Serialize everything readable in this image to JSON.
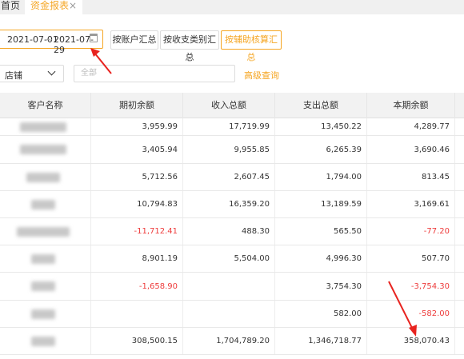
{
  "tabs": [
    {
      "label": "首页"
    },
    {
      "label": "资金报表",
      "close": "×"
    }
  ],
  "filters": {
    "date_start": "2021-07-01",
    "date_sep": "~",
    "date_end": "2021-07-29",
    "buttons": [
      "按账户汇总",
      "按收支类别汇总",
      "按辅助核算汇总"
    ],
    "active_button": "按辅助核算汇总",
    "shop_label": "店铺",
    "search_placeholder": "全部",
    "advanced_query": "高级查询"
  },
  "table": {
    "headers": [
      "客户名称",
      "期初余额",
      "收入总额",
      "支出总额",
      "本期余额"
    ],
    "rows": [
      {
        "opening": "3,959.99",
        "income": "17,719.99",
        "expense": "13,450.22",
        "balance": "4,289.77"
      },
      {
        "opening": "3,405.94",
        "income": "9,955.85",
        "expense": "6,265.39",
        "balance": "3,690.46"
      },
      {
        "opening": "5,712.56",
        "income": "2,607.45",
        "expense": "1,794.00",
        "balance": "813.45"
      },
      {
        "opening": "10,794.83",
        "income": "16,359.20",
        "expense": "13,189.59",
        "balance": "3,169.61"
      },
      {
        "opening": "-11,712.41",
        "income": "488.30",
        "expense": "565.50",
        "balance": "-77.20"
      },
      {
        "opening": "8,901.19",
        "income": "5,504.00",
        "expense": "4,996.30",
        "balance": "507.70"
      },
      {
        "opening": "-1,658.90",
        "income": "",
        "expense": "3,754.30",
        "balance": "-3,754.30"
      },
      {
        "opening": "",
        "income": "",
        "expense": "582.00",
        "balance": "-582.00"
      },
      {
        "opening": "308,500.15",
        "income": "1,704,789.20",
        "expense": "1,346,718.77",
        "balance": "358,070.43"
      }
    ]
  },
  "colors": {
    "accent": "#f5a623",
    "negative": "#ee3c3c",
    "annotation": "#e8231f"
  }
}
